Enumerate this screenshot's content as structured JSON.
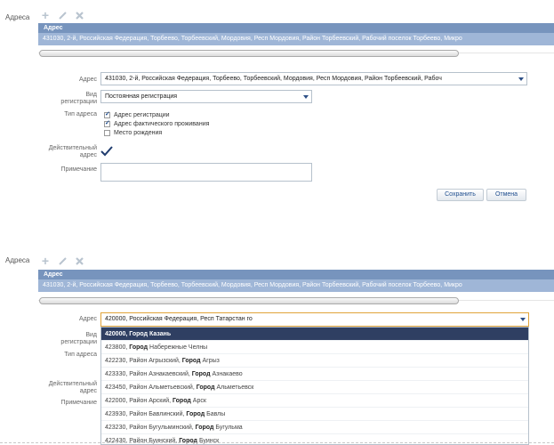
{
  "top": {
    "section_label": "Адреса",
    "grid_header": "Адрес",
    "grid_row": "431030, 2-й, Российская Федерация, Торбеево, Торбеевский, Мордовия, Респ Мордовия, Район Торбеевский, Рабочий поселок Торбеево, Микро",
    "form": {
      "address_label": "Адрес",
      "address_value": "431030, 2-й, Российская Федерация, Торбеево, Торбеевский, Мордовия, Респ Мордовия, Район Торбеевский, Рабоч",
      "reg_type_label_1": "Вид",
      "reg_type_label_2": "регистрации",
      "reg_type_value": "Постоянная регистрация",
      "addr_type_label": "Тип адреса",
      "checkboxes": [
        {
          "label": "Адрес регистрации",
          "checked": true
        },
        {
          "label": "Адрес фактического проживания",
          "checked": true
        },
        {
          "label": "Место рождения",
          "checked": false
        }
      ],
      "valid_label_1": "Действительный",
      "valid_label_2": "адрес",
      "note_label": "Примечание",
      "note_value": "",
      "save_label": "Сохранить",
      "cancel_label": "Отмена"
    }
  },
  "bottom": {
    "section_label": "Адреса",
    "grid_header": "Адрес",
    "grid_row": "431030, 2-й, Российская Федерация, Торбеево, Торбеевский, Мордовия, Респ Мордовия, Район Торбеевский, Рабочий поселок Торбеево, Микро",
    "form": {
      "address_label": "Адрес",
      "address_value": "420000, Российская Федерация, Респ Татарстан го",
      "reg_type_label_1": "Вид",
      "reg_type_label_2": "регистрации",
      "addr_type_label": "Тип адреса",
      "valid_label_1": "Действительный",
      "valid_label_2": "адрес",
      "note_label": "Примечание"
    },
    "suggestions": [
      {
        "prefix": "420000, ",
        "bold": "Город",
        "rest": " Казань"
      },
      {
        "prefix": "423800, ",
        "bold": "Город",
        "rest": " Набережные Челны"
      },
      {
        "prefix": "422230, Район Агрызский, ",
        "bold": "Город",
        "rest": " Агрыз"
      },
      {
        "prefix": "423330, Район Азнакаевский, ",
        "bold": "Город",
        "rest": " Азнакаево"
      },
      {
        "prefix": "423450, Район Альметьевский, ",
        "bold": "Город",
        "rest": " Альметьевск"
      },
      {
        "prefix": "422000, Район Арский, ",
        "bold": "Город",
        "rest": " Арск"
      },
      {
        "prefix": "423930, Район Бавлинский, ",
        "bold": "Город",
        "rest": " Бавлы"
      },
      {
        "prefix": "423230, Район Бугульминский, ",
        "bold": "Город",
        "rest": " Бугульма"
      },
      {
        "prefix": "422430, Район Буинский, ",
        "bold": "Город",
        "rest": " Буинск"
      }
    ]
  },
  "colors": {
    "grid_header": "#7794bd",
    "grid_row": "#9fb6d7",
    "selected_item": "#2f3f62",
    "focus_border": "#e0a33a"
  },
  "icons": [
    "add-icon",
    "edit-icon",
    "delete-icon"
  ]
}
